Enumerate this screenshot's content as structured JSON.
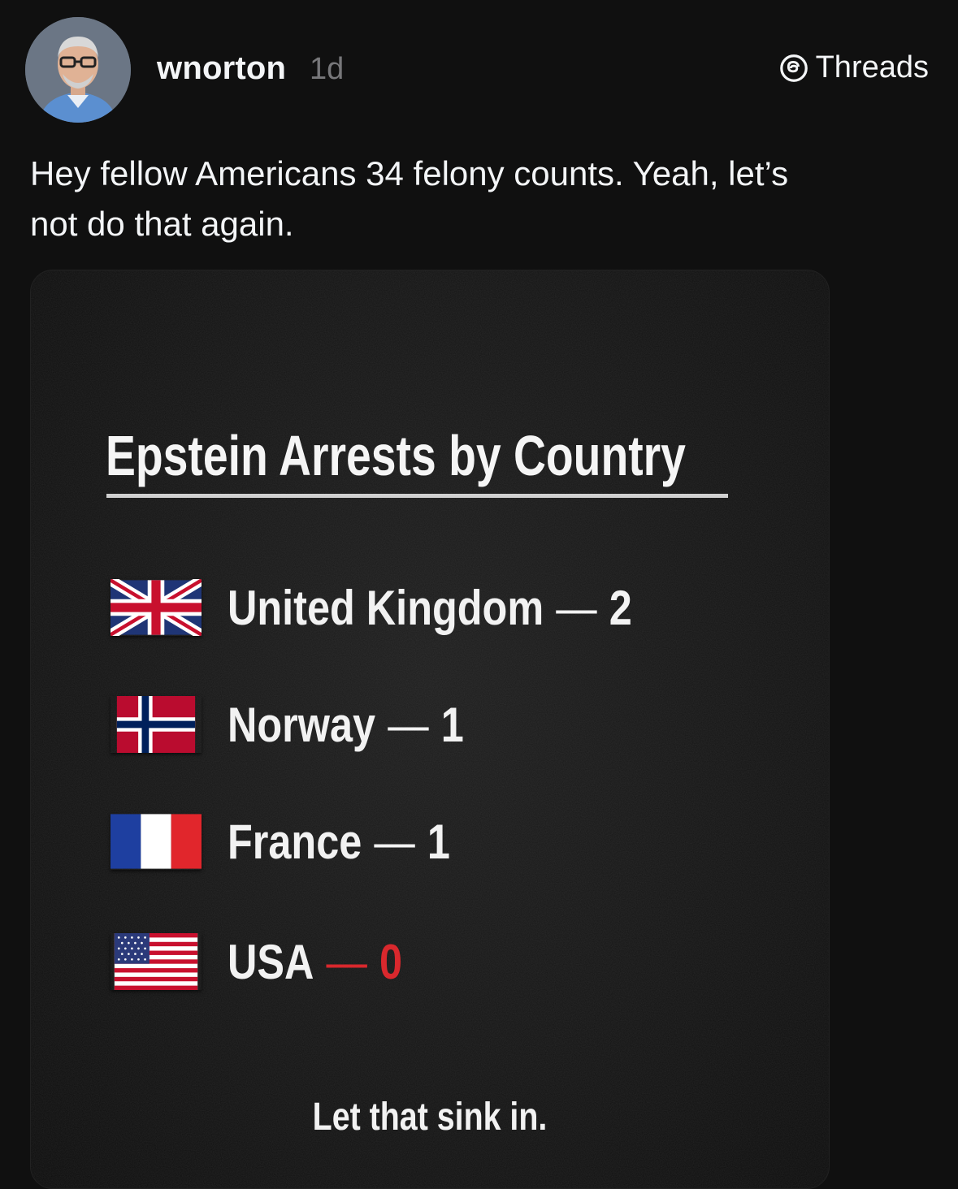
{
  "post": {
    "username": "wnorton",
    "timestamp": "1d",
    "platform_label": "Threads",
    "text_line1": "Hey fellow Americans 34 felony counts.  Yeah, let’s",
    "text_line2": "not do that again."
  },
  "image": {
    "title": "Epstein Arrests by Country",
    "rows": [
      {
        "country": "United Kingdom",
        "dash": "—",
        "count": "2",
        "flag": "uk-flag"
      },
      {
        "country": "Norway",
        "dash": "—",
        "count": "1",
        "flag": "norway-flag"
      },
      {
        "country": "France",
        "dash": "—",
        "count": "1",
        "flag": "france-flag"
      },
      {
        "country": "USA",
        "dash": "—",
        "count": "0",
        "flag": "usa-flag"
      }
    ],
    "footer": "Let that sink in.",
    "colors": {
      "highlight": "#d9282d",
      "text": "#f2f2f2",
      "background": "#141414"
    }
  }
}
